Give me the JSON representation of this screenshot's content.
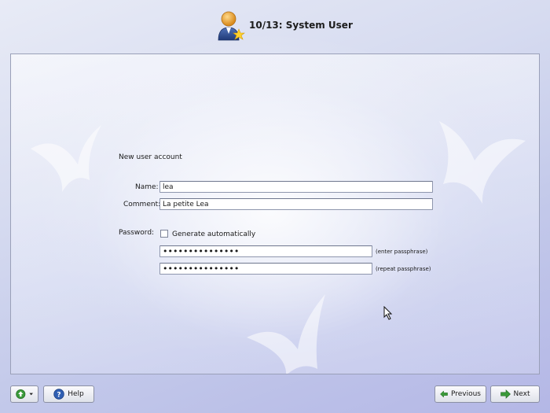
{
  "header": {
    "title": "10/13: System User",
    "icon": "user-add-icon"
  },
  "form": {
    "section_title": "New user account",
    "name_label": "Name:",
    "name_value": "lea",
    "comment_label": "Comment:",
    "comment_value": "La petite Lea",
    "password_label": "Password:",
    "generate_label": "Generate automatically",
    "generate_checked": false,
    "password_value": "•••••••••••••••",
    "password_hint": "(enter passphrase)",
    "repeat_value": "•••••••••••••••",
    "repeat_hint": "(repeat passphrase)"
  },
  "footer": {
    "menu_icon": "arrow-up-circle-icon",
    "help_label": "Help",
    "previous_label": "Previous",
    "next_label": "Next"
  },
  "colors": {
    "accent_green": "#3a9a3a",
    "help_blue": "#2f5fb3",
    "user_orange": "#e8a23c"
  }
}
